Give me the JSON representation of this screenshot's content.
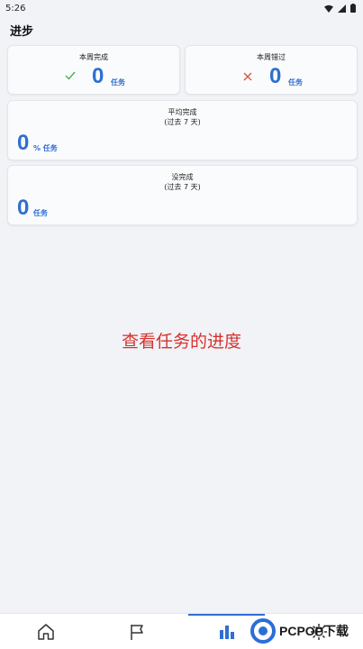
{
  "status_bar": {
    "time": "5:26"
  },
  "page_title": "进步",
  "cards": {
    "week_done": {
      "title": "本周完成",
      "value": "0",
      "unit": "任务"
    },
    "week_missed": {
      "title": "本周错过",
      "value": "0",
      "unit": "任务"
    },
    "avg_done": {
      "title": "平均完成",
      "sub": "(过去 7 天)",
      "value": "0",
      "unit": "% 任务"
    },
    "not_done": {
      "title": "没完成",
      "sub": "(过去 7 天)",
      "value": "0",
      "unit": "任务"
    }
  },
  "center_message": "查看任务的进度",
  "bottom_nav": {
    "items": [
      "home-icon",
      "flag-icon",
      "bar-chart-icon",
      "settings-icon"
    ],
    "active_index": 2
  },
  "watermark": {
    "text": "PCPOP下载"
  },
  "colors": {
    "accent": "#2f6fd1",
    "check": "#4caf50",
    "cross": "#e0533c",
    "message": "#d6322f"
  }
}
